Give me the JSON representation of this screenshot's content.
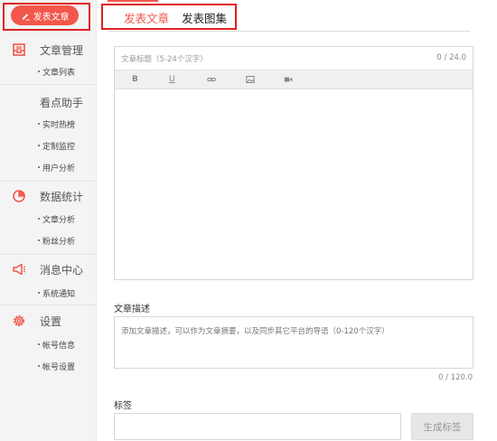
{
  "sidebar": {
    "publish_label": "发表文章",
    "sections": [
      {
        "title": "文章管理",
        "icon": "inbox-icon",
        "items": [
          "文章列表"
        ]
      },
      {
        "title": "看点助手",
        "icon": "",
        "items": [
          "实时热榜",
          "定制监控",
          "用户分析"
        ]
      },
      {
        "title": "数据统计",
        "icon": "pie-chart-icon",
        "items": [
          "文章分析",
          "粉丝分析"
        ]
      },
      {
        "title": "消息中心",
        "icon": "megaphone-icon",
        "items": [
          "系统通知"
        ]
      },
      {
        "title": "设置",
        "icon": "gear-icon",
        "items": [
          "帐号信息",
          "帐号设置"
        ]
      }
    ]
  },
  "tabs": [
    "发表文章",
    "发表图集"
  ],
  "active_tab": "发表文章",
  "editor": {
    "title_placeholder": "文章标题（5-24个汉字）",
    "title_count": "0 / 24.0",
    "toolbar": [
      "bold-icon",
      "underline-icon",
      "link-icon",
      "image-icon",
      "video-icon"
    ]
  },
  "description": {
    "label": "文章描述",
    "placeholder": "添加文章描述，可以作为文章摘要，以及同步其它平台的导语（0-120个汉字）",
    "count": "0 / 120.0"
  },
  "tags": {
    "label": "标签",
    "generate_label": "生成标签"
  },
  "colors": {
    "accent": "#f2574b",
    "highlight_border": "#e02020"
  }
}
